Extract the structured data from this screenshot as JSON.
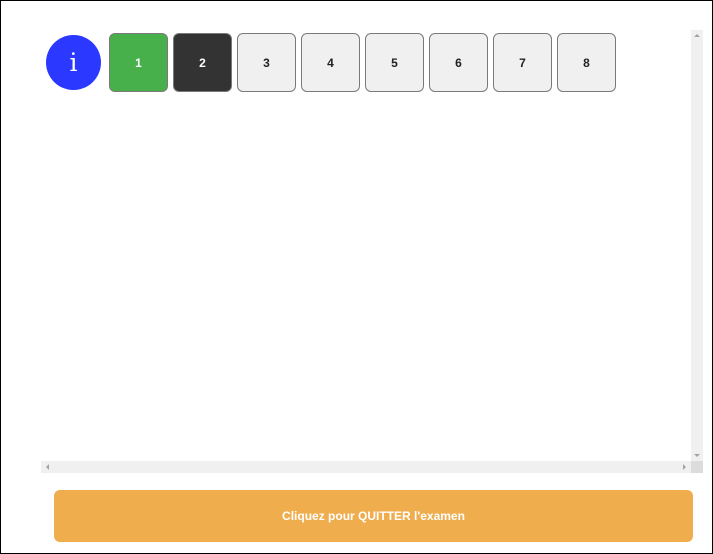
{
  "info_button": {
    "label": "i",
    "color": "#2b38ff"
  },
  "questions": [
    {
      "label": "1",
      "state": "answered"
    },
    {
      "label": "2",
      "state": "current"
    },
    {
      "label": "3",
      "state": "default"
    },
    {
      "label": "4",
      "state": "default"
    },
    {
      "label": "5",
      "state": "default"
    },
    {
      "label": "6",
      "state": "default"
    },
    {
      "label": "7",
      "state": "default"
    },
    {
      "label": "8",
      "state": "default"
    }
  ],
  "quit_button": {
    "label": "Cliquez pour QUITTER l'examen",
    "color": "#efad4e"
  },
  "colors": {
    "answered": "#47b04b",
    "current": "#333333",
    "default": "#f0f0f0"
  },
  "icons": {
    "scroll_up": "chevron-up-icon",
    "scroll_down": "chevron-down-icon",
    "scroll_left": "chevron-left-icon",
    "scroll_right": "chevron-right-icon"
  }
}
